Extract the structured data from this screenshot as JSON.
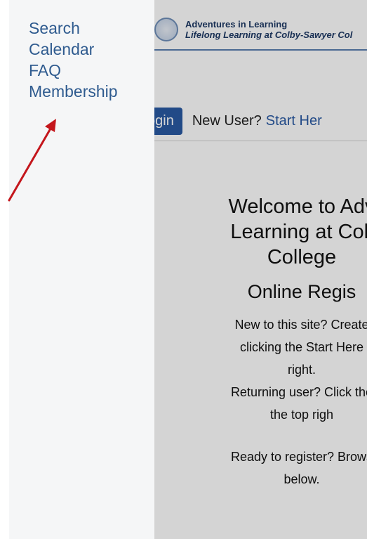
{
  "drawer": {
    "items": [
      {
        "label": "Search"
      },
      {
        "label": "Calendar"
      },
      {
        "label": "FAQ"
      },
      {
        "label": "Membership"
      }
    ]
  },
  "banner": {
    "title": "Adventures in Learning",
    "subtitle": "Lifelong Learning at Colby-Sawyer Col"
  },
  "topbar": {
    "login_label": "ogin",
    "new_user_text": "New User?",
    "start_link": "Start Her"
  },
  "welcome": {
    "heading_line1": "Welcome to Adv",
    "heading_line2": "Learning at Coll",
    "heading_line3": "College",
    "subheading": "Online Regis",
    "p1_line1": "New to this site? Create",
    "p1_line2": "clicking the Start Here",
    "p1_line3": "right.",
    "p2_line1": "Returning user? Click the",
    "p2_line2": "the top righ",
    "p3_line1": "Ready to register? Brows",
    "p3_line2": "below."
  },
  "colors": {
    "accent": "#2a5aa3",
    "menu_link": "#2f5b8f",
    "arrow": "#c4161c"
  }
}
